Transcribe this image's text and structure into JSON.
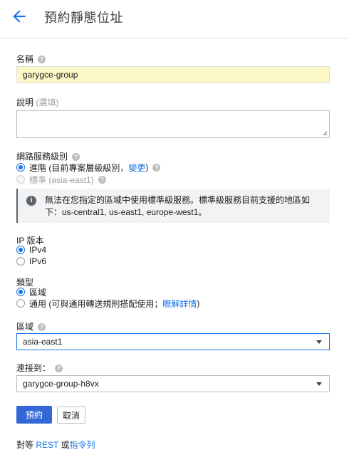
{
  "header": {
    "title": "預約靜態位址"
  },
  "name_field": {
    "label": "名稱",
    "value": "garygce-group"
  },
  "description_field": {
    "label": "說明",
    "optional": "(選填)"
  },
  "network_tier": {
    "label": "網路服務級別",
    "options": [
      {
        "text": "進階 (目前專案層級級別，",
        "link": "變更",
        "suffix": ")",
        "checked": true
      },
      {
        "text": "標準 (asia-east1)",
        "checked": false,
        "disabled": true
      }
    ]
  },
  "info": {
    "message": "無法在您指定的區域中使用標準級服務。標準級服務目前支援的地區如下：us-central1, us-east1, europe-west1。"
  },
  "ip_version": {
    "label": "IP 版本",
    "options": [
      {
        "text": "IPv4",
        "checked": true
      },
      {
        "text": "IPv6",
        "checked": false
      }
    ]
  },
  "type": {
    "label": "類型",
    "options": [
      {
        "text": "區域",
        "checked": true
      },
      {
        "text": "通用 (可與通用轉送規則搭配使用；",
        "link": "瞭解詳情",
        "suffix": ")",
        "checked": false
      }
    ]
  },
  "region": {
    "label": "區域",
    "value": "asia-east1"
  },
  "attached_to": {
    "label": "連接到：",
    "value": "garygce-group-h8vx"
  },
  "buttons": {
    "reserve": "預約",
    "cancel": "取消"
  },
  "footer": {
    "prefix": "對等 ",
    "rest": "REST",
    "middle": " 或",
    "cli": "指令列"
  },
  "colors": {
    "accent": "#1a73e8",
    "primary_button": "#3367d6",
    "input_highlight": "#fbf8c5"
  }
}
